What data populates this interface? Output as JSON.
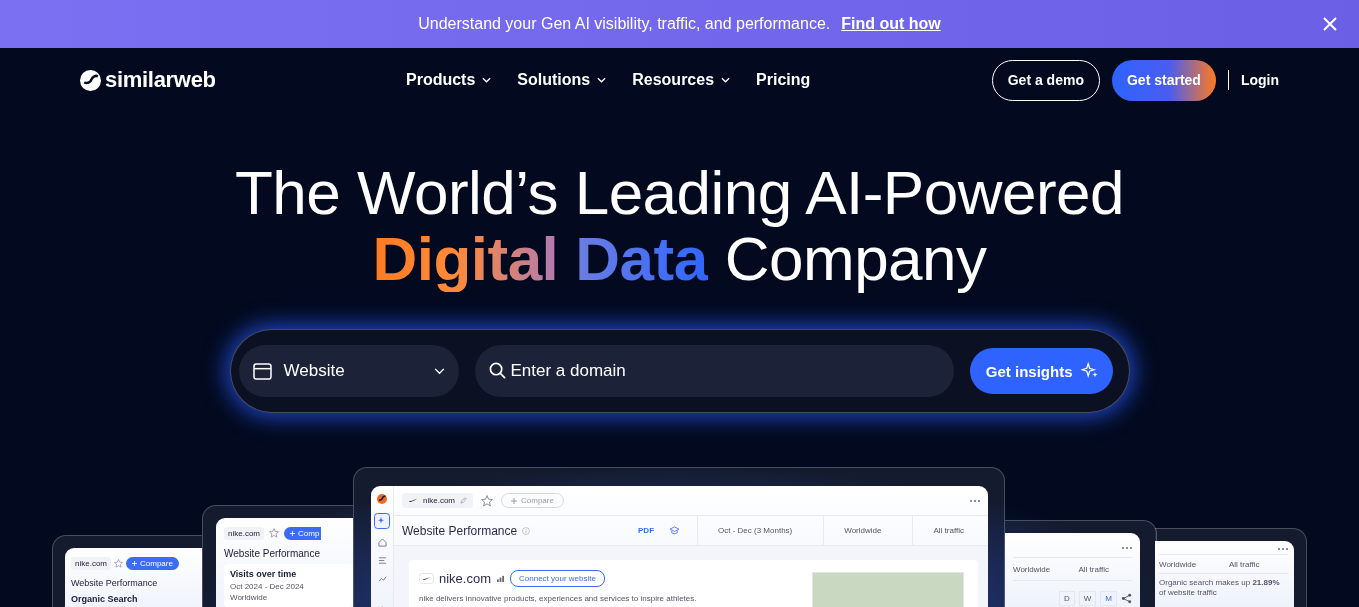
{
  "banner": {
    "text": "Understand your Gen AI visibility, traffic, and performance.",
    "link": "Find out how"
  },
  "nav": {
    "logo": "similarweb",
    "items": [
      {
        "label": "Products",
        "dropdown": true
      },
      {
        "label": "Solutions",
        "dropdown": true
      },
      {
        "label": "Resources",
        "dropdown": true
      },
      {
        "label": "Pricing",
        "dropdown": false
      }
    ],
    "buttons": [
      {
        "label": "Get a demo",
        "kind": "outline"
      },
      {
        "label": "Get started",
        "kind": "gradient"
      },
      {
        "label": "Login",
        "kind": "plain"
      }
    ]
  },
  "hero": {
    "line1": "The World’s Leading AI-Powered",
    "line2": [
      {
        "text": "Digital",
        "kind": "orange"
      },
      {
        "text": "Data",
        "kind": "blue"
      },
      {
        "text": "Company",
        "kind": "plain"
      }
    ]
  },
  "search": {
    "type": "Website",
    "placeholder": "Enter a domain",
    "button": "Get insights"
  },
  "previews": {
    "far_left": {
      "domain": "nike.com",
      "compare": "Compare",
      "title": "Website Performance",
      "section": "Organic Search"
    },
    "left": {
      "domain": "nike.com",
      "compare": "Comp",
      "title": "Website Performance",
      "card_title": "Visits over time",
      "date": "Oct 2024 - Dec 2024",
      "region": "Worldwide"
    },
    "center": {
      "domain": "nike.com",
      "compare": "Compare",
      "title": "Website Performance",
      "pdf": "PDF",
      "date": "Oct - Dec (3 Months)",
      "region": "Worldwide",
      "traffic": "All traffic",
      "site": "nike.com",
      "connect": "Connect your website",
      "description": "nike delivers innovative products, experiences and services to inspire athletes."
    },
    "right": {
      "region": "Worldwide",
      "traffic": "All traffic",
      "periods": [
        {
          "label": "D",
          "selected": false
        },
        {
          "label": "W",
          "selected": false
        },
        {
          "label": "M",
          "selected": true
        }
      ]
    },
    "far_right": {
      "region": "Worldwide",
      "traffic": "All traffic",
      "note": "Organic search makes up **21.89%** of website traffic"
    }
  }
}
